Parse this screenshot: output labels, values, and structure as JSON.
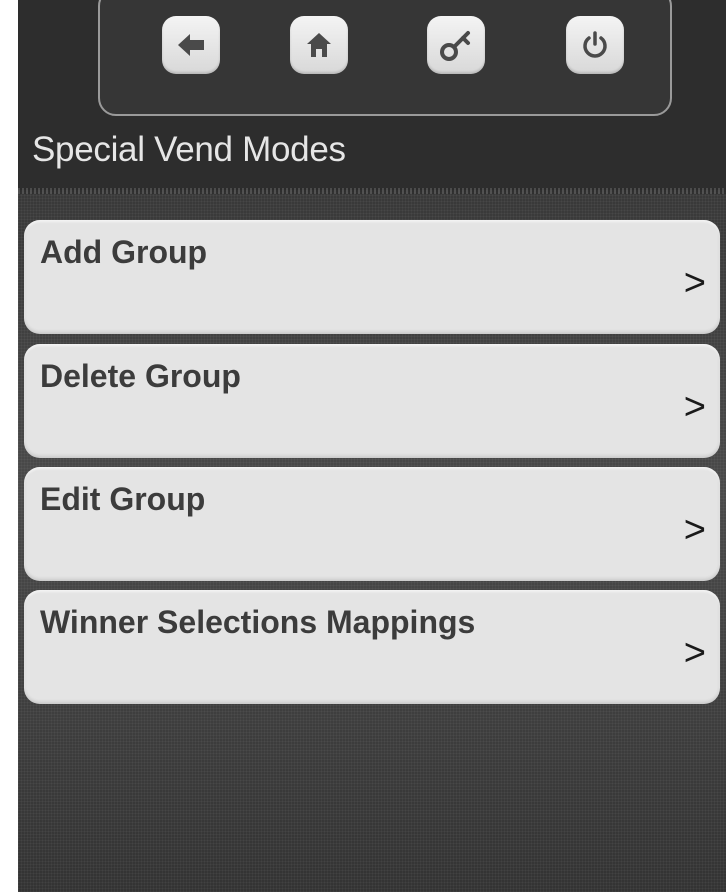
{
  "nav": {
    "back_icon": "arrow-left-icon",
    "home_icon": "home-icon",
    "key_icon": "key-icon",
    "power_icon": "power-icon"
  },
  "page": {
    "title": "Special Vend Modes"
  },
  "menu": {
    "items": [
      {
        "label": "Add Group",
        "arrow": ">"
      },
      {
        "label": "Delete Group",
        "arrow": ">"
      },
      {
        "label": "Edit Group",
        "arrow": ">"
      },
      {
        "label": "Winner Selections Mappings",
        "arrow": ">"
      }
    ]
  },
  "colors": {
    "background": "#2d2d2d",
    "button_face": "#e4e4e4",
    "title_text": "#e6e6e6",
    "label_text": "#3c3c3c"
  }
}
